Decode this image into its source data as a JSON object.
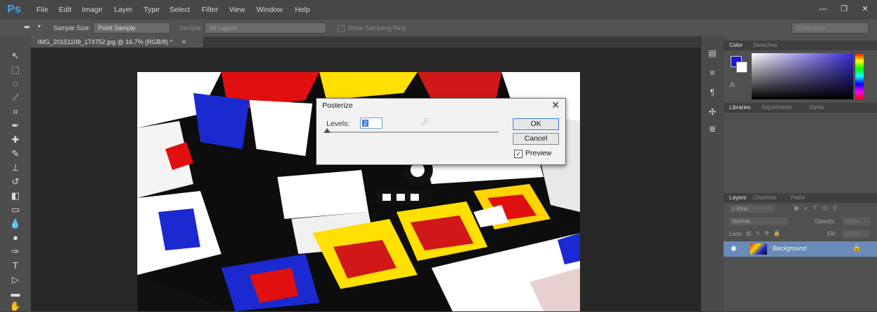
{
  "app": {
    "logo": "Ps"
  },
  "menu": [
    "File",
    "Edit",
    "Image",
    "Layer",
    "Type",
    "Select",
    "Filter",
    "View",
    "Window",
    "Help"
  ],
  "options_bar": {
    "sample_size_label": "Sample Size:",
    "sample_size_value": "Point Sample",
    "sample_label": "Sample:",
    "sample_value": "All Layers",
    "show_ring_label": "Show Sampling Ring",
    "workspace": "Essentials"
  },
  "document_tab": {
    "title": "IMG_20151108_174752.jpg @ 16.7% (RGB/8) *"
  },
  "dialog": {
    "title": "Posterize",
    "levels_label": "Levels:",
    "levels_value": "2",
    "ok_label": "OK",
    "cancel_label": "Cancel",
    "preview_label": "Preview",
    "preview_checked": true
  },
  "color_panel": {
    "tabs": [
      "Color",
      "Swatches"
    ],
    "foreground": "#1a1adb",
    "background": "#ffffff"
  },
  "libraries_panel": {
    "tabs": [
      "Libraries",
      "Adjustments",
      "Styles"
    ]
  },
  "layers_panel": {
    "tabs": [
      "Layers",
      "Channels",
      "Paths"
    ],
    "filter_label": "Kind",
    "blend_mode": "Normal",
    "opacity_label": "Opacity:",
    "opacity_value": "100%",
    "lock_label": "Lock:",
    "fill_label": "Fill:",
    "fill_value": "100%",
    "layers": [
      {
        "name": "Background"
      }
    ]
  }
}
